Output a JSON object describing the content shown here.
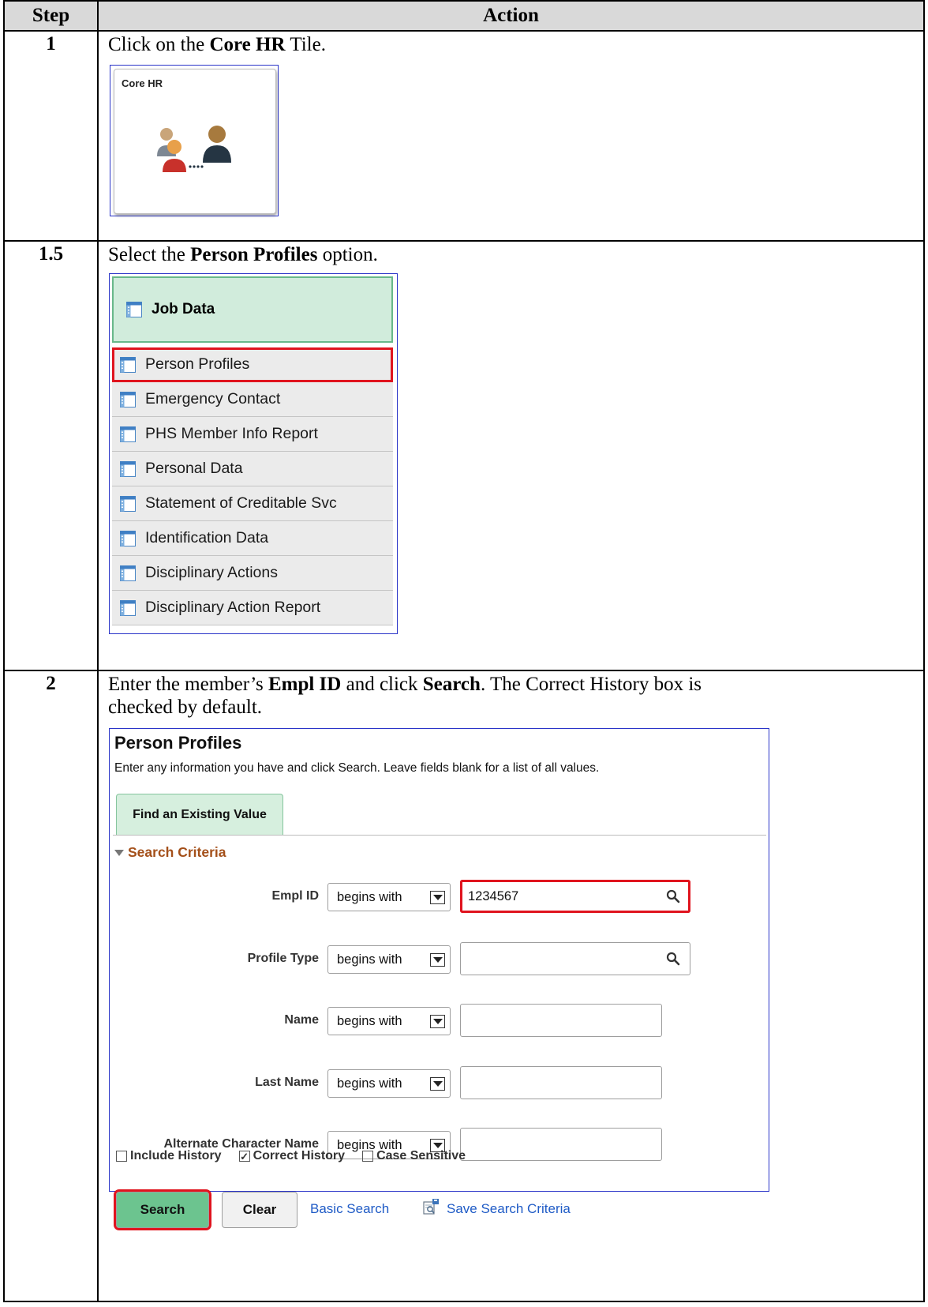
{
  "table": {
    "headers": [
      "Step",
      "Action"
    ]
  },
  "steps": [
    {
      "number": "1",
      "pre": "Click on the ",
      "bold": "Core HR",
      "post": " Tile.",
      "tile": {
        "title": "Core HR",
        "icon": "people-connection-icon"
      }
    },
    {
      "number": "1.5",
      "pre": "Select the ",
      "bold": "Person Profiles",
      "post": " option.",
      "menu": {
        "header": "Job Data",
        "items": [
          "Person Profiles",
          "Emergency Contact",
          "PHS Member Info Report",
          "Personal Data",
          "Statement of Creditable Svc",
          "Identification Data",
          "Disciplinary Actions",
          "Disciplinary Action Report"
        ],
        "selected_index": 0
      }
    },
    {
      "number": "2",
      "pre": "Enter the member’s ",
      "bold": "Empl ID",
      "mid": " and click ",
      "bold2": "Search",
      "post": ".  The Correct History box is",
      "line2": "checked by default.",
      "search_page": {
        "title": "Person Profiles",
        "hint": "Enter any information you have and click Search. Leave fields blank for a list of all values.",
        "tab": "Find an Existing Value",
        "section": "Search Criteria",
        "fields": [
          {
            "label": "Empl ID",
            "operator": "begins with",
            "value": "1234567",
            "lookup": true
          },
          {
            "label": "Profile Type",
            "operator": "begins with",
            "value": "",
            "lookup": true
          },
          {
            "label": "Name",
            "operator": "begins with",
            "value": "",
            "lookup": false
          },
          {
            "label": "Last Name",
            "operator": "begins with",
            "value": "",
            "lookup": false
          },
          {
            "label": "Alternate Character Name",
            "operator": "begins with",
            "value": "",
            "lookup": false
          }
        ],
        "checkboxes": [
          {
            "label": "Include History",
            "checked": false
          },
          {
            "label": "Correct History",
            "checked": true
          },
          {
            "label": "Case Sensitive",
            "checked": false
          }
        ],
        "buttons": {
          "search": "Search",
          "clear": "Clear"
        },
        "links": {
          "basic_search": "Basic Search",
          "save_search": "Save Search Criteria"
        }
      }
    }
  ],
  "colors": {
    "highlight": "#e0141e",
    "frame": "#2a34c8",
    "tab_green": "#d6efde",
    "search_button": "#6cc48f",
    "section_title": "#a4501a",
    "link": "#1f5bc6"
  }
}
